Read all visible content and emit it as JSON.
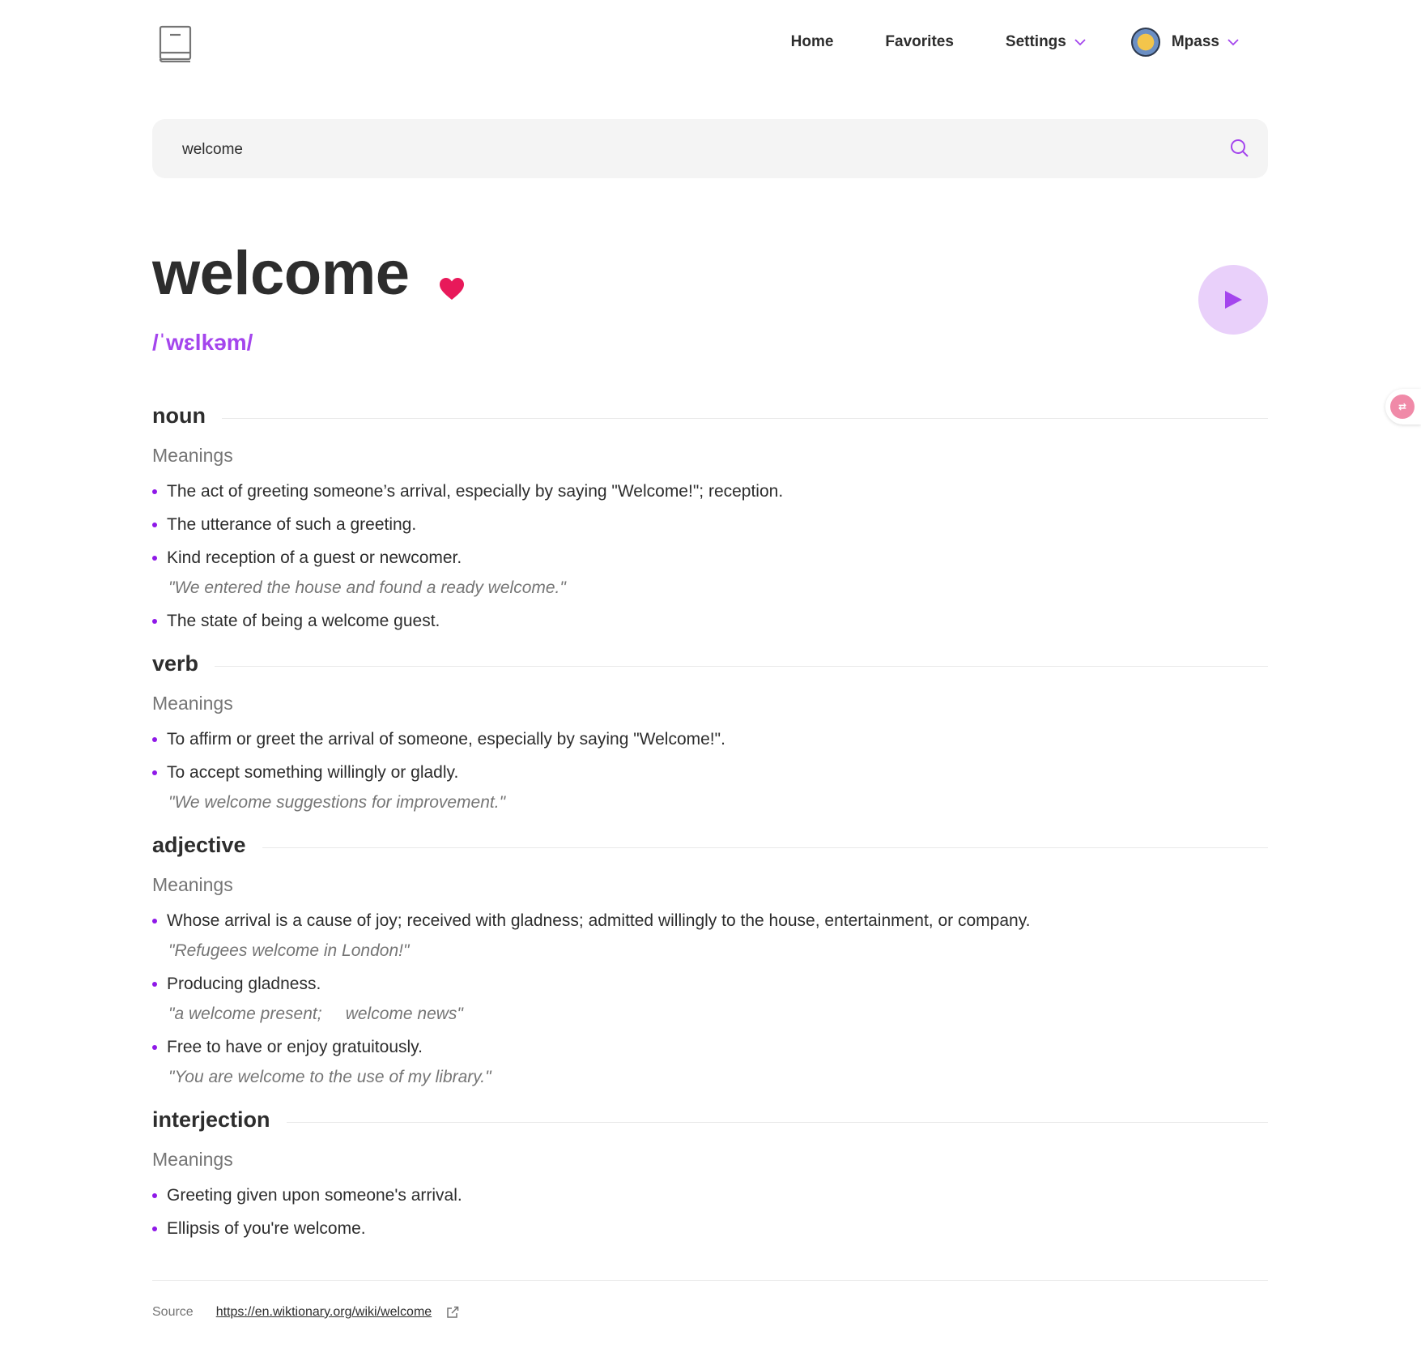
{
  "nav": {
    "home": "Home",
    "favorites": "Favorites",
    "settings": "Settings",
    "user": "Mpass"
  },
  "search": {
    "value": "welcome"
  },
  "word": {
    "text": "welcome",
    "phonetic": "/ˈwɛlkəm/",
    "favorited": true
  },
  "sections": [
    {
      "pos": "noun",
      "meanings_label": "Meanings",
      "definitions": [
        {
          "text": "The act of greeting someone’s arrival, especially by saying \"Welcome!\"; reception."
        },
        {
          "text": "The utterance of such a greeting."
        },
        {
          "text": "Kind reception of a guest or newcomer.",
          "example": "\"We entered the house and found a ready welcome.\""
        },
        {
          "text": "The state of being a welcome guest."
        }
      ]
    },
    {
      "pos": "verb",
      "meanings_label": "Meanings",
      "definitions": [
        {
          "text": "To affirm or greet the arrival of someone, especially by saying \"Welcome!\"."
        },
        {
          "text": "To accept something willingly or gladly.",
          "example": "\"We welcome suggestions for improvement.\""
        }
      ]
    },
    {
      "pos": "adjective",
      "meanings_label": "Meanings",
      "definitions": [
        {
          "text": "Whose arrival is a cause of joy; received with gladness; admitted willingly to the house, entertainment, or company.",
          "example": "\"Refugees welcome in London!\""
        },
        {
          "text": "Producing gladness.",
          "example": "\"a welcome present;     welcome news\""
        },
        {
          "text": "Free to have or enjoy gratuitously.",
          "example": "\"You are welcome to the use of my library.\""
        }
      ]
    },
    {
      "pos": "interjection",
      "meanings_label": "Meanings",
      "definitions": [
        {
          "text": "Greeting given upon someone's arrival."
        },
        {
          "text": "Ellipsis of you're welcome."
        }
      ]
    }
  ],
  "source": {
    "label": "Source",
    "url": "https://en.wiktionary.org/wiki/welcome"
  },
  "colors": {
    "accent": "#a445ed",
    "heart": "#e8195a",
    "text": "#2d2d2d",
    "muted": "#757575"
  }
}
